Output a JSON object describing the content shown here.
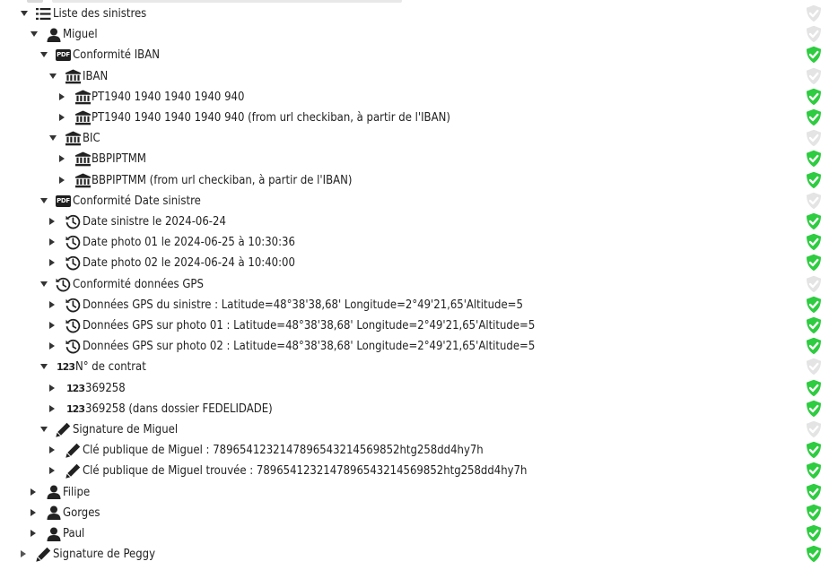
{
  "colors": {
    "shield_valid": "#2ecc40",
    "shield_pending": "#e4e4e4",
    "text": "#222222"
  },
  "rows": [
    {
      "level": 0,
      "toggle": "expanded",
      "icon": "list-icon",
      "label": "Liste des sinistres",
      "status": "pending"
    },
    {
      "level": 1,
      "toggle": "expanded",
      "icon": "user-icon",
      "label": "Miguel",
      "status": "pending"
    },
    {
      "level": 2,
      "toggle": "expanded",
      "icon": "pdf-icon",
      "label": "Conformité IBAN",
      "status": "valid"
    },
    {
      "level": 3,
      "toggle": "expanded",
      "icon": "bank-icon",
      "label": "IBAN",
      "status": "pending"
    },
    {
      "level": 4,
      "toggle": "collapsed",
      "icon": "bank-icon",
      "label": "PT1940 1940 1940 1940 940",
      "status": "valid"
    },
    {
      "level": 4,
      "toggle": "collapsed",
      "icon": "bank-icon",
      "label": "PT1940 1940 1940 1940 940 (from url checkiban, à partir de l'IBAN)",
      "status": "valid"
    },
    {
      "level": 3,
      "toggle": "expanded",
      "icon": "bank-icon",
      "label": "BIC",
      "status": "pending"
    },
    {
      "level": 4,
      "toggle": "collapsed",
      "icon": "bank-icon",
      "label": "BBPIPTMM",
      "status": "valid"
    },
    {
      "level": 4,
      "toggle": "collapsed",
      "icon": "bank-icon",
      "label": "BBPIPTMM (from url checkiban, à partir de l'IBAN)",
      "status": "valid"
    },
    {
      "level": 2,
      "toggle": "expanded",
      "icon": "pdf-icon",
      "label": "Conformité Date sinistre",
      "status": "pending"
    },
    {
      "level": 3,
      "toggle": "collapsed",
      "icon": "history-icon",
      "label": "Date sinistre le 2024-06-24",
      "status": "valid"
    },
    {
      "level": 3,
      "toggle": "collapsed",
      "icon": "history-icon",
      "label": "Date photo 01 le 2024-06-25 à 10:30:36",
      "status": "valid"
    },
    {
      "level": 3,
      "toggle": "collapsed",
      "icon": "history-icon",
      "label": "Date photo 02 le 2024-06-24 à 10:40:00",
      "status": "valid"
    },
    {
      "level": 2,
      "toggle": "expanded",
      "icon": "history-icon",
      "label": "Conformité données GPS",
      "status": "pending"
    },
    {
      "level": 3,
      "toggle": "collapsed",
      "icon": "history-icon",
      "label": "Données GPS du sinistre : Latitude=48°38'38,68' Longitude=2°49'21,65'Altitude=5",
      "status": "valid"
    },
    {
      "level": 3,
      "toggle": "collapsed",
      "icon": "history-icon",
      "label": "Données GPS sur photo 01 : Latitude=48°38'38,68' Longitude=2°49'21,65'Altitude=5",
      "status": "valid"
    },
    {
      "level": 3,
      "toggle": "collapsed",
      "icon": "history-icon",
      "label": "Données GPS sur photo 02 : Latitude=48°38'38,68' Longitude=2°49'21,65'Altitude=5",
      "status": "valid"
    },
    {
      "level": 2,
      "toggle": "expanded",
      "icon": "numbers-icon",
      "label": "N° de contrat",
      "status": "pending"
    },
    {
      "level": 3,
      "toggle": "collapsed",
      "icon": "numbers-icon",
      "label": "369258",
      "status": "valid"
    },
    {
      "level": 3,
      "toggle": "collapsed",
      "icon": "numbers-icon",
      "label": "369258 (dans dossier FEDELIDADE)",
      "status": "valid"
    },
    {
      "level": 2,
      "toggle": "expanded",
      "icon": "signature-icon",
      "label": "Signature de Miguel",
      "status": "pending"
    },
    {
      "level": 3,
      "toggle": "collapsed",
      "icon": "signature-icon",
      "label": "Clé publique de Miguel : 789654123214789654321456985 2htg258dd4hy7h",
      "status": "valid"
    },
    {
      "level": 3,
      "toggle": "collapsed",
      "icon": "signature-icon",
      "label": "Clé publique de Miguel trouvée : 7896541232147896543214569852htg258dd4hy7h",
      "status": "valid"
    },
    {
      "level": 1,
      "toggle": "collapsed",
      "icon": "user-icon",
      "label": "Filipe",
      "status": "valid"
    },
    {
      "level": 1,
      "toggle": "collapsed",
      "icon": "user-icon",
      "label": "Gorges",
      "status": "valid"
    },
    {
      "level": 1,
      "toggle": "collapsed",
      "icon": "user-icon",
      "label": "Paul",
      "status": "valid"
    },
    {
      "level": 0,
      "toggle": "collapsed-outline",
      "icon": "signature-icon",
      "label": "Signature de Peggy",
      "status": "valid"
    }
  ]
}
